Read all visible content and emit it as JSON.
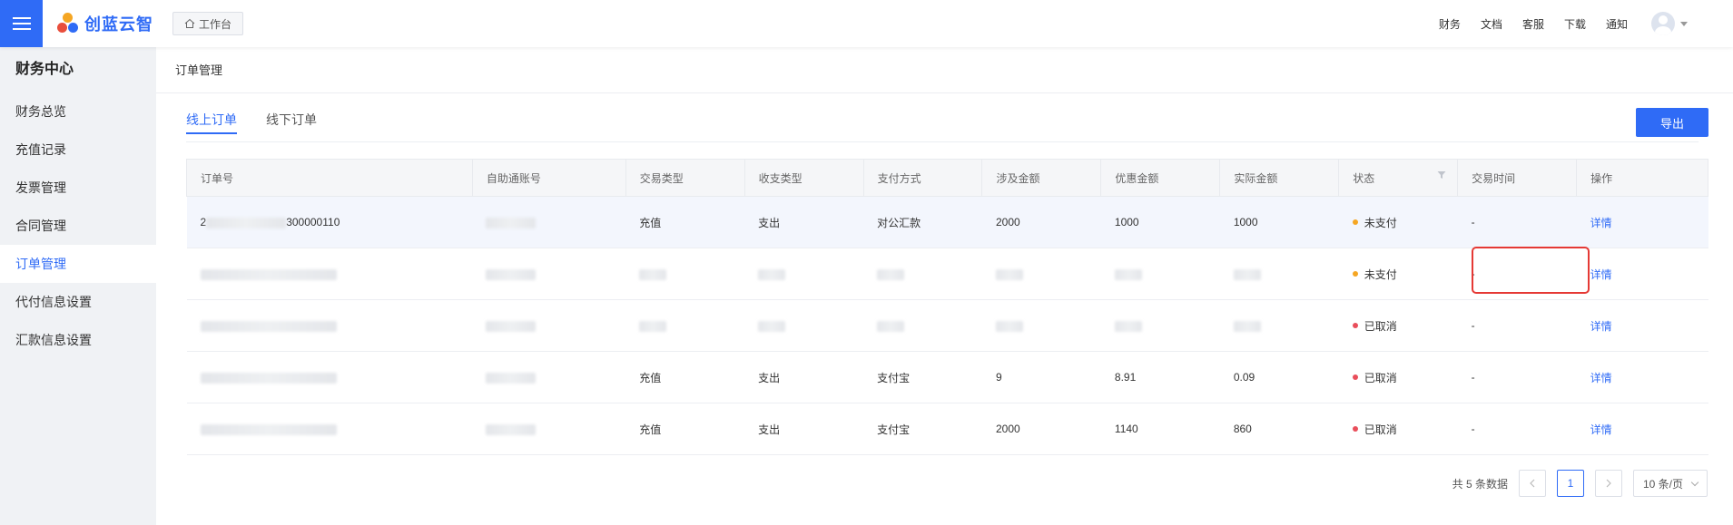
{
  "header": {
    "logo_text": "创蓝云智",
    "workbench_label": "工作台",
    "nav": [
      "财务",
      "文档",
      "客服",
      "下载",
      "通知"
    ]
  },
  "sidebar": {
    "title": "财务中心",
    "items": [
      "财务总览",
      "充值记录",
      "发票管理",
      "合同管理",
      "订单管理",
      "代付信息设置",
      "汇款信息设置"
    ],
    "active": "订单管理"
  },
  "breadcrumb": "订单管理",
  "tabs": [
    "线上订单",
    "线下订单"
  ],
  "export_label": "导出",
  "table": {
    "columns": [
      "订单号",
      "自助通账号",
      "交易类型",
      "收支类型",
      "支付方式",
      "涉及金额",
      "优惠金额",
      "实际金额",
      "状态",
      "交易时间",
      "操作"
    ],
    "rows": [
      {
        "order_no": "2",
        "order_tail": "300000110",
        "type": "充值",
        "io": "支出",
        "pay": "对公汇款",
        "amount": "2000",
        "discount": "1000",
        "actual": "1000",
        "status": "未支付",
        "time": "-",
        "op": "详情"
      },
      {
        "order_no": "",
        "order_tail": "",
        "type": "",
        "io": "",
        "pay": "",
        "amount": "",
        "discount": "",
        "actual": "",
        "status": "未支付",
        "time": "-",
        "op": "详情"
      },
      {
        "order_no": "",
        "order_tail": "",
        "type": "",
        "io": "",
        "pay": "",
        "amount": "",
        "discount": "",
        "actual": "",
        "status": "已取消",
        "time": "-",
        "op": "详情"
      },
      {
        "order_no": "",
        "order_tail": "",
        "type": "充值",
        "io": "支出",
        "pay": "支付宝",
        "amount": "9",
        "discount": "8.91",
        "actual": "0.09",
        "status": "已取消",
        "time": "-",
        "op": "详情"
      },
      {
        "order_no": "",
        "order_tail": "",
        "type": "充值",
        "io": "支出",
        "pay": "支付宝",
        "amount": "2000",
        "discount": "1140",
        "actual": "860",
        "status": "已取消",
        "time": "-",
        "op": "详情"
      }
    ]
  },
  "status_colors": {
    "未支付": "#f5a623",
    "已取消": "#e94e5b"
  },
  "pagination": {
    "total_text": "共 5 条数据",
    "current_page": "1",
    "page_size": "10 条/页"
  },
  "colors": {
    "accent": "#2f6bf6",
    "highlight": "#e53935"
  }
}
